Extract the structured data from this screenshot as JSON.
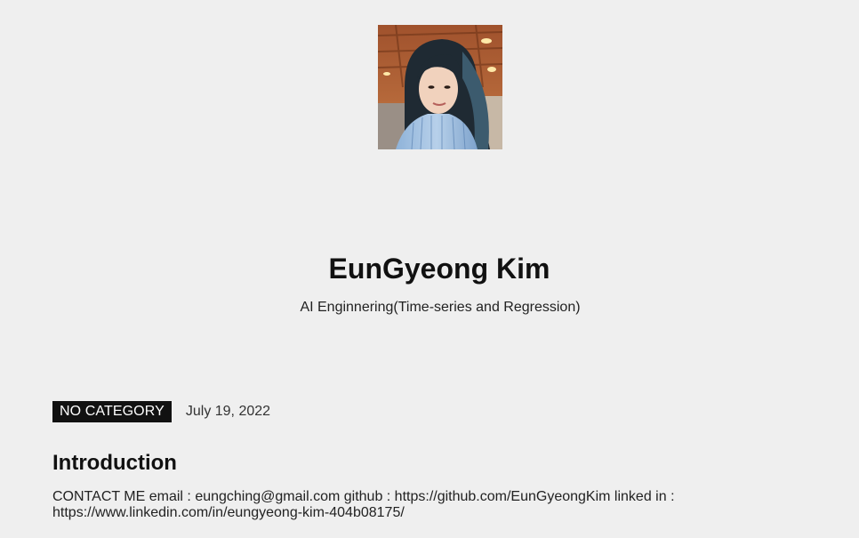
{
  "site": {
    "title": "EunGyeong Kim",
    "tagline": "AI Enginnering(Time-series and Regression)"
  },
  "post": {
    "category": "NO CATEGORY",
    "date": "July 19, 2022",
    "title": "Introduction",
    "excerpt": "CONTACT ME email : eungching@gmail.com github : https://github.com/EunGyeongKim linked in : https://www.linkedin.com/in/eungyeong-kim-404b08175/"
  },
  "colors": {
    "background": "#efefef",
    "badge_bg": "#111111",
    "badge_text": "#ffffff"
  }
}
